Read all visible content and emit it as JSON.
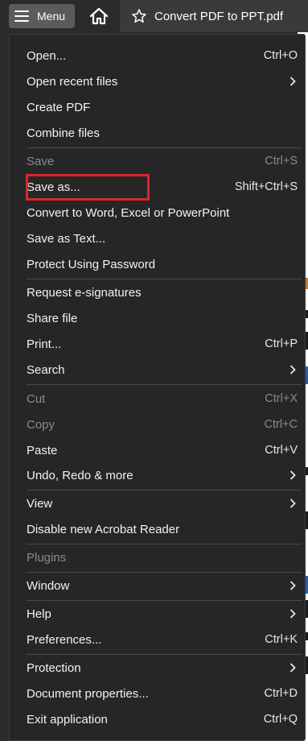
{
  "topbar": {
    "menu_label": "Menu",
    "tab_title": "Convert PDF to PPT.pdf"
  },
  "menu": {
    "items": [
      {
        "label": "Open...",
        "shortcut": "Ctrl+O",
        "submenu": false,
        "disabled": false
      },
      {
        "label": "Open recent files",
        "shortcut": "",
        "submenu": true,
        "disabled": false
      },
      {
        "label": "Create PDF",
        "shortcut": "",
        "submenu": false,
        "disabled": false
      },
      {
        "label": "Combine files",
        "shortcut": "",
        "submenu": false,
        "disabled": false
      },
      {
        "label": "Save",
        "shortcut": "Ctrl+S",
        "submenu": false,
        "disabled": true
      },
      {
        "label": "Save as...",
        "shortcut": "Shift+Ctrl+S",
        "submenu": false,
        "disabled": false
      },
      {
        "label": "Convert to Word, Excel or PowerPoint",
        "shortcut": "",
        "submenu": false,
        "disabled": false
      },
      {
        "label": "Save as Text...",
        "shortcut": "",
        "submenu": false,
        "disabled": false
      },
      {
        "label": "Protect Using Password",
        "shortcut": "",
        "submenu": false,
        "disabled": false
      },
      {
        "label": "Request e-signatures",
        "shortcut": "",
        "submenu": false,
        "disabled": false
      },
      {
        "label": "Share file",
        "shortcut": "",
        "submenu": false,
        "disabled": false
      },
      {
        "label": "Print...",
        "shortcut": "Ctrl+P",
        "submenu": false,
        "disabled": false
      },
      {
        "label": "Search",
        "shortcut": "",
        "submenu": true,
        "disabled": false
      },
      {
        "label": "Cut",
        "shortcut": "Ctrl+X",
        "submenu": false,
        "disabled": true
      },
      {
        "label": "Copy",
        "shortcut": "Ctrl+C",
        "submenu": false,
        "disabled": true
      },
      {
        "label": "Paste",
        "shortcut": "Ctrl+V",
        "submenu": false,
        "disabled": false
      },
      {
        "label": "Undo, Redo & more",
        "shortcut": "",
        "submenu": true,
        "disabled": false
      },
      {
        "label": "View",
        "shortcut": "",
        "submenu": true,
        "disabled": false
      },
      {
        "label": "Disable new Acrobat Reader",
        "shortcut": "",
        "submenu": false,
        "disabled": false
      },
      {
        "label": "Plugins",
        "shortcut": "",
        "submenu": false,
        "disabled": true
      },
      {
        "label": "Window",
        "shortcut": "",
        "submenu": true,
        "disabled": false
      },
      {
        "label": "Help",
        "shortcut": "",
        "submenu": true,
        "disabled": false
      },
      {
        "label": "Preferences...",
        "shortcut": "Ctrl+K",
        "submenu": false,
        "disabled": false
      },
      {
        "label": "Protection",
        "shortcut": "",
        "submenu": true,
        "disabled": false
      },
      {
        "label": "Document properties...",
        "shortcut": "Ctrl+D",
        "submenu": false,
        "disabled": false
      },
      {
        "label": "Exit application",
        "shortcut": "Ctrl+Q",
        "submenu": false,
        "disabled": false
      }
    ]
  },
  "colors": {
    "menu_bg": "#262626",
    "highlight_border": "#d9262d",
    "disabled_text": "#8a8a8a"
  }
}
